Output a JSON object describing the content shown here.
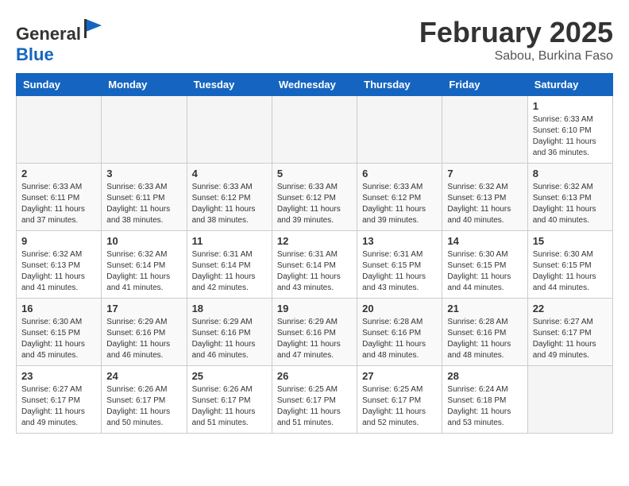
{
  "header": {
    "logo_general": "General",
    "logo_blue": "Blue",
    "month": "February 2025",
    "location": "Sabou, Burkina Faso"
  },
  "days_of_week": [
    "Sunday",
    "Monday",
    "Tuesday",
    "Wednesday",
    "Thursday",
    "Friday",
    "Saturday"
  ],
  "weeks": [
    [
      {
        "day": "",
        "detail": ""
      },
      {
        "day": "",
        "detail": ""
      },
      {
        "day": "",
        "detail": ""
      },
      {
        "day": "",
        "detail": ""
      },
      {
        "day": "",
        "detail": ""
      },
      {
        "day": "",
        "detail": ""
      },
      {
        "day": "1",
        "detail": "Sunrise: 6:33 AM\nSunset: 6:10 PM\nDaylight: 11 hours\nand 36 minutes."
      }
    ],
    [
      {
        "day": "2",
        "detail": "Sunrise: 6:33 AM\nSunset: 6:11 PM\nDaylight: 11 hours\nand 37 minutes."
      },
      {
        "day": "3",
        "detail": "Sunrise: 6:33 AM\nSunset: 6:11 PM\nDaylight: 11 hours\nand 38 minutes."
      },
      {
        "day": "4",
        "detail": "Sunrise: 6:33 AM\nSunset: 6:12 PM\nDaylight: 11 hours\nand 38 minutes."
      },
      {
        "day": "5",
        "detail": "Sunrise: 6:33 AM\nSunset: 6:12 PM\nDaylight: 11 hours\nand 39 minutes."
      },
      {
        "day": "6",
        "detail": "Sunrise: 6:33 AM\nSunset: 6:12 PM\nDaylight: 11 hours\nand 39 minutes."
      },
      {
        "day": "7",
        "detail": "Sunrise: 6:32 AM\nSunset: 6:13 PM\nDaylight: 11 hours\nand 40 minutes."
      },
      {
        "day": "8",
        "detail": "Sunrise: 6:32 AM\nSunset: 6:13 PM\nDaylight: 11 hours\nand 40 minutes."
      }
    ],
    [
      {
        "day": "9",
        "detail": "Sunrise: 6:32 AM\nSunset: 6:13 PM\nDaylight: 11 hours\nand 41 minutes."
      },
      {
        "day": "10",
        "detail": "Sunrise: 6:32 AM\nSunset: 6:14 PM\nDaylight: 11 hours\nand 41 minutes."
      },
      {
        "day": "11",
        "detail": "Sunrise: 6:31 AM\nSunset: 6:14 PM\nDaylight: 11 hours\nand 42 minutes."
      },
      {
        "day": "12",
        "detail": "Sunrise: 6:31 AM\nSunset: 6:14 PM\nDaylight: 11 hours\nand 43 minutes."
      },
      {
        "day": "13",
        "detail": "Sunrise: 6:31 AM\nSunset: 6:15 PM\nDaylight: 11 hours\nand 43 minutes."
      },
      {
        "day": "14",
        "detail": "Sunrise: 6:30 AM\nSunset: 6:15 PM\nDaylight: 11 hours\nand 44 minutes."
      },
      {
        "day": "15",
        "detail": "Sunrise: 6:30 AM\nSunset: 6:15 PM\nDaylight: 11 hours\nand 44 minutes."
      }
    ],
    [
      {
        "day": "16",
        "detail": "Sunrise: 6:30 AM\nSunset: 6:15 PM\nDaylight: 11 hours\nand 45 minutes."
      },
      {
        "day": "17",
        "detail": "Sunrise: 6:29 AM\nSunset: 6:16 PM\nDaylight: 11 hours\nand 46 minutes."
      },
      {
        "day": "18",
        "detail": "Sunrise: 6:29 AM\nSunset: 6:16 PM\nDaylight: 11 hours\nand 46 minutes."
      },
      {
        "day": "19",
        "detail": "Sunrise: 6:29 AM\nSunset: 6:16 PM\nDaylight: 11 hours\nand 47 minutes."
      },
      {
        "day": "20",
        "detail": "Sunrise: 6:28 AM\nSunset: 6:16 PM\nDaylight: 11 hours\nand 48 minutes."
      },
      {
        "day": "21",
        "detail": "Sunrise: 6:28 AM\nSunset: 6:16 PM\nDaylight: 11 hours\nand 48 minutes."
      },
      {
        "day": "22",
        "detail": "Sunrise: 6:27 AM\nSunset: 6:17 PM\nDaylight: 11 hours\nand 49 minutes."
      }
    ],
    [
      {
        "day": "23",
        "detail": "Sunrise: 6:27 AM\nSunset: 6:17 PM\nDaylight: 11 hours\nand 49 minutes."
      },
      {
        "day": "24",
        "detail": "Sunrise: 6:26 AM\nSunset: 6:17 PM\nDaylight: 11 hours\nand 50 minutes."
      },
      {
        "day": "25",
        "detail": "Sunrise: 6:26 AM\nSunset: 6:17 PM\nDaylight: 11 hours\nand 51 minutes."
      },
      {
        "day": "26",
        "detail": "Sunrise: 6:25 AM\nSunset: 6:17 PM\nDaylight: 11 hours\nand 51 minutes."
      },
      {
        "day": "27",
        "detail": "Sunrise: 6:25 AM\nSunset: 6:17 PM\nDaylight: 11 hours\nand 52 minutes."
      },
      {
        "day": "28",
        "detail": "Sunrise: 6:24 AM\nSunset: 6:18 PM\nDaylight: 11 hours\nand 53 minutes."
      },
      {
        "day": "",
        "detail": ""
      }
    ]
  ]
}
